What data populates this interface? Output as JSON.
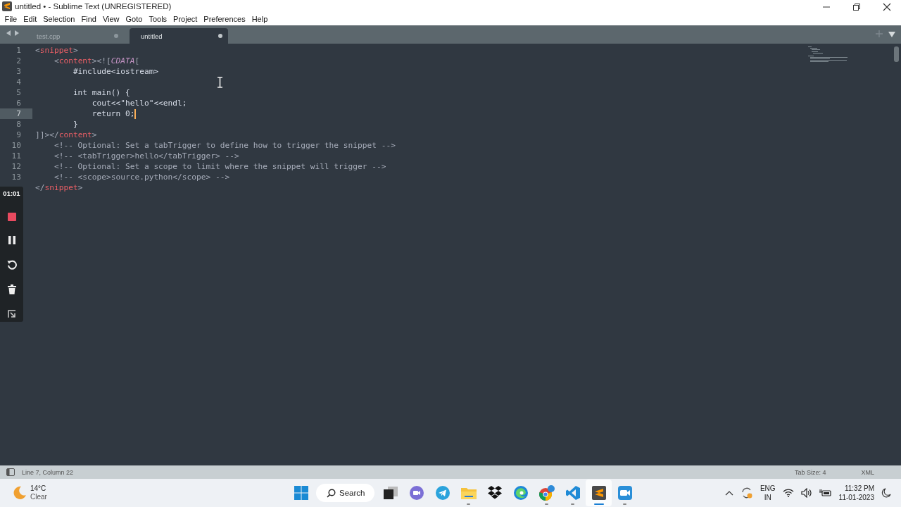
{
  "window": {
    "title": "untitled • - Sublime Text (UNREGISTERED)"
  },
  "menu": [
    "File",
    "Edit",
    "Selection",
    "Find",
    "View",
    "Goto",
    "Tools",
    "Project",
    "Preferences",
    "Help"
  ],
  "tabs": [
    {
      "label": "test.cpp",
      "selected": false
    },
    {
      "label": "untitled",
      "selected": true
    }
  ],
  "editor": {
    "lines": [
      {
        "number": "1",
        "current": false,
        "tokens": [
          {
            "kind": "punct",
            "text": "<"
          },
          {
            "kind": "tag",
            "text": "snippet"
          },
          {
            "kind": "punct",
            "text": ">"
          }
        ]
      },
      {
        "number": "2",
        "current": false,
        "tokens": [
          {
            "kind": "punct",
            "text": "    <"
          },
          {
            "kind": "tag",
            "text": "content"
          },
          {
            "kind": "punct",
            "text": "><!["
          },
          {
            "kind": "cdata",
            "text": "CDATA"
          },
          {
            "kind": "punct",
            "text": "["
          }
        ]
      },
      {
        "number": "3",
        "current": false,
        "tokens": [
          {
            "kind": "plain",
            "text": "        #include<iostream>"
          }
        ]
      },
      {
        "number": "4",
        "current": false
      },
      {
        "number": "5",
        "current": false,
        "tokens": [
          {
            "kind": "plain",
            "text": "        int main() {"
          }
        ]
      },
      {
        "number": "6",
        "current": false,
        "tokens": [
          {
            "kind": "plain",
            "text": "            cout<<\"hello\"<<endl;"
          }
        ]
      },
      {
        "number": "7",
        "current": true,
        "tokens": [
          {
            "kind": "plain",
            "text": "            return 0;"
          }
        ]
      },
      {
        "number": "8",
        "current": false,
        "tokens": [
          {
            "kind": "plain",
            "text": "        }"
          }
        ]
      },
      {
        "number": "9",
        "current": false,
        "tokens": [
          {
            "kind": "punct",
            "text": "]]></"
          },
          {
            "kind": "tag",
            "text": "content"
          },
          {
            "kind": "punct",
            "text": ">"
          }
        ]
      },
      {
        "number": "10",
        "current": false,
        "tokens": [
          {
            "kind": "comment",
            "text": "    <!-- Optional: Set a tabTrigger to define how to trigger the snippet -->"
          }
        ]
      },
      {
        "number": "11",
        "current": false,
        "tokens": [
          {
            "kind": "comment",
            "text": "    <!-- <tabTrigger>hello</tabTrigger> -->"
          }
        ]
      },
      {
        "number": "12",
        "current": false,
        "tokens": [
          {
            "kind": "comment",
            "text": "    <!-- Optional: Set a scope to limit where the snippet will trigger -->"
          }
        ]
      },
      {
        "number": "13",
        "current": false,
        "tokens": [
          {
            "kind": "comment",
            "text": "    <!-- <scope>source.python</scope> -->"
          }
        ]
      },
      {
        "current": false,
        "tokens": [
          {
            "kind": "punct",
            "text": "</"
          },
          {
            "kind": "tag",
            "text": "snippet"
          },
          {
            "kind": "punct",
            "text": ">"
          }
        ]
      }
    ]
  },
  "recorder": {
    "timer": "01:01"
  },
  "status_bar": {
    "position": "Line 7, Column 22",
    "tab_size": "Tab Size: 4",
    "syntax": "XML"
  },
  "taskbar": {
    "weather": {
      "temperature": "14°C",
      "condition": "Clear"
    },
    "search": "Search",
    "apps": [
      {
        "kind": "taskview",
        "active": false
      },
      {
        "kind": "chat",
        "active": false
      },
      {
        "kind": "telegram",
        "active": false
      },
      {
        "kind": "folder",
        "active": true
      },
      {
        "kind": "dropbox",
        "active": false
      },
      {
        "kind": "edge",
        "active": false
      },
      {
        "kind": "chrome",
        "active": true
      },
      {
        "kind": "vscode",
        "active": true
      },
      {
        "kind": "sublime",
        "active": true
      },
      {
        "kind": "zoom",
        "active": true
      }
    ],
    "language": "ENG",
    "region": "IN",
    "time": "11:32 PM",
    "date": "11-01-2023"
  }
}
